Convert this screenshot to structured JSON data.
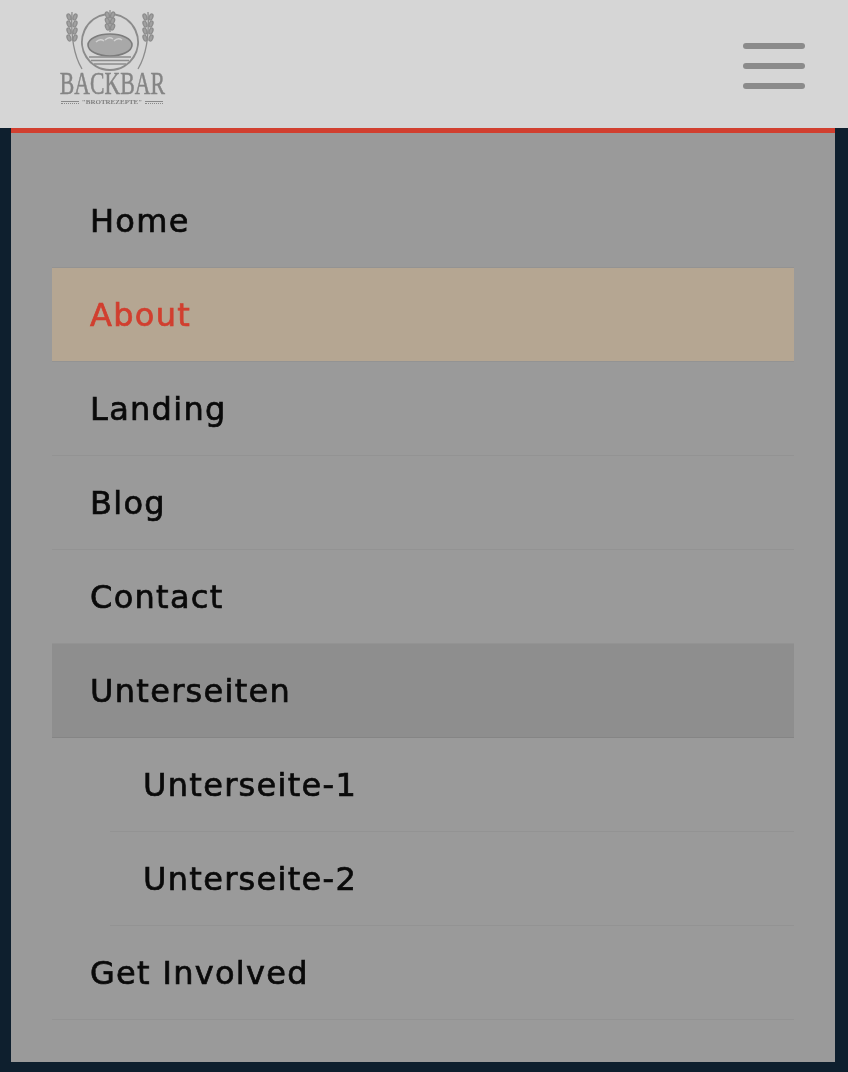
{
  "header": {
    "logo": {
      "wordmark": "BACKBAR",
      "tagline": "\"BROTREZEPTE\""
    }
  },
  "menu": {
    "items": [
      {
        "label": "Home",
        "selected": false
      },
      {
        "label": "About",
        "selected": true
      },
      {
        "label": "Landing",
        "selected": false
      },
      {
        "label": "Blog",
        "selected": false
      },
      {
        "label": "Contact",
        "selected": false
      },
      {
        "label": "Unterseiten",
        "selected": false,
        "expanded": true,
        "children": [
          {
            "label": "Unterseite-1",
            "selected": false
          },
          {
            "label": "Unterseite-2",
            "selected": false
          }
        ]
      },
      {
        "label": "Get Involved",
        "selected": false
      }
    ]
  }
}
